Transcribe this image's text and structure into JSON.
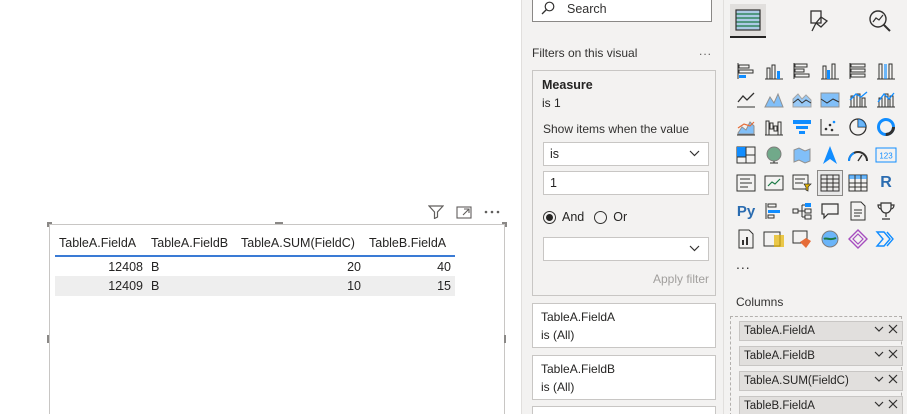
{
  "visual": {
    "table": {
      "headers": [
        "TableA.FieldA",
        "TableA.FieldB",
        "TableA.SUM(FieldC)",
        "TableB.FieldA"
      ],
      "rows": [
        [
          "12408",
          "B",
          "20",
          "40"
        ],
        [
          "12409",
          "B",
          "10",
          "15"
        ]
      ]
    }
  },
  "filters": {
    "search_placeholder": "Search",
    "section_title": "Filters on this visual",
    "more": "...",
    "measure_card": {
      "title": "Measure",
      "summary": "is 1",
      "show_items_label": "Show items when the value",
      "operator": "is",
      "value": "1",
      "logic_and": "And",
      "logic_or": "Or",
      "apply_label": "Apply filter"
    },
    "card_field_a": {
      "title": "TableA.FieldA",
      "summary": "is (All)"
    },
    "card_field_b": {
      "title": "TableA.FieldB",
      "summary": "is (All)"
    }
  },
  "viz": {
    "more": "...",
    "columns_label": "Columns",
    "fields": [
      {
        "label": "TableA.FieldA"
      },
      {
        "label": "TableA.FieldB"
      },
      {
        "label": "TableA.SUM(FieldC)"
      },
      {
        "label": "TableB.FieldA"
      }
    ],
    "r_label": "R",
    "py_label": "Py",
    "card_number": "123"
  },
  "colors": {
    "accent_blue": "#118dff",
    "header_line": "#3a7bd5",
    "pane_bg": "#f3f2f1"
  }
}
